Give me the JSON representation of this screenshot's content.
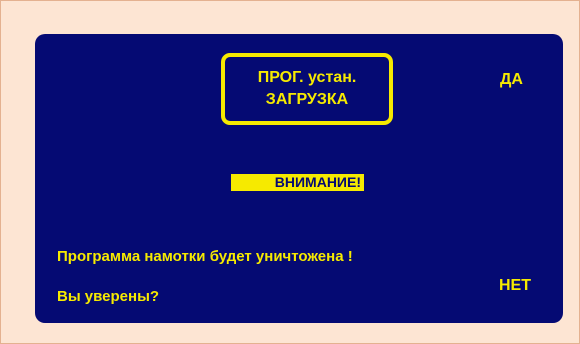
{
  "screen": {
    "title_line1": "ПРОГ. устан.",
    "title_line2": "ЗАГРУЗКА",
    "yes_label": "ДА",
    "no_label": "НЕТ",
    "warning": "ВНИМАНИЕ!",
    "message_line1": "Программа намотки будет уничтожена !",
    "message_line2": "Вы уверены?"
  },
  "colors": {
    "background": "#fde5d3",
    "screen": "#050a73",
    "accent": "#f6ea00"
  }
}
